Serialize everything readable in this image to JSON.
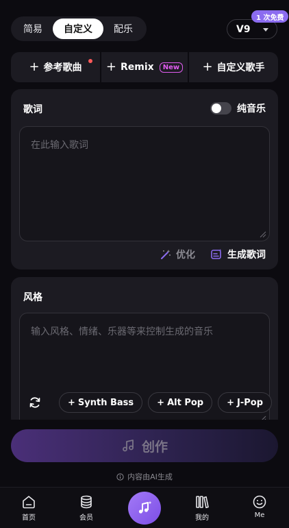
{
  "mode_tabs": [
    "简易",
    "自定义",
    "配乐"
  ],
  "version": {
    "label": "V9",
    "badge": "1 次免费"
  },
  "actions": {
    "reference_song": "参考歌曲",
    "remix": "Remix",
    "remix_tag": "New",
    "custom_singer": "自定义歌手"
  },
  "lyrics": {
    "title": "歌词",
    "instrumental_label": "纯音乐",
    "placeholder": "在此输入歌词",
    "optimize": "优化",
    "generate": "生成歌词"
  },
  "style": {
    "title": "风格",
    "placeholder": "输入风格、情绪、乐器等来控制生成的音乐",
    "chips": [
      "Synth Bass",
      "Alt Pop",
      "J-Pop"
    ]
  },
  "create_label": "创作",
  "ai_note": "内容由AI生成",
  "nav": {
    "home": "首页",
    "member": "会员",
    "mine": "我的",
    "me": "Me"
  },
  "colors": {
    "accent": "#8b6cf0",
    "new_tag": "#e05cf0",
    "dot": "#ff5a5a"
  }
}
